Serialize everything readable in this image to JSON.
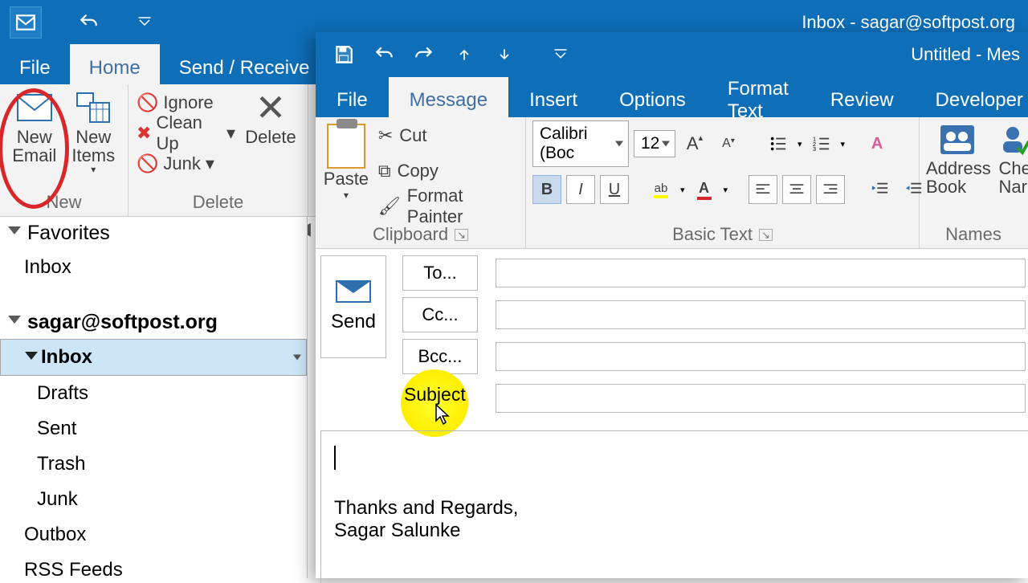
{
  "main": {
    "title_suffix": "Inbox - sagar@softpost.org",
    "menubar": {
      "file": "File",
      "home": "Home",
      "sendrecv": "Send / Receive"
    },
    "ribbon": {
      "new_email": "New\nEmail",
      "new_items": "New\nItems",
      "new_group": "New",
      "ignore": "Ignore",
      "cleanup": "Clean Up",
      "junk": "Junk",
      "delete": "Delete",
      "delete_group": "Delete"
    },
    "nav": {
      "favorites": "Favorites",
      "fav_inbox": "Inbox",
      "account": "sagar@softpost.org",
      "inbox": "Inbox",
      "drafts": "Drafts",
      "sent": "Sent",
      "trash": "Trash",
      "junk": "Junk",
      "outbox": "Outbox",
      "rss": "RSS Feeds"
    }
  },
  "compose": {
    "title": "Untitled - Mes",
    "tabs": {
      "file": "File",
      "message": "Message",
      "insert": "Insert",
      "options": "Options",
      "format": "Format Text",
      "review": "Review",
      "developer": "Developer"
    },
    "clipboard": {
      "paste": "Paste",
      "cut": "Cut",
      "copy": "Copy",
      "format_painter": "Format Painter",
      "group": "Clipboard"
    },
    "basic_text": {
      "font": "Calibri (Boc",
      "size": "12",
      "group": "Basic Text"
    },
    "names": {
      "address_book": "Address\nBook",
      "check_names": "Che\nNar",
      "group": "Names"
    },
    "header": {
      "to": "To...",
      "cc": "Cc...",
      "bcc": "Bcc...",
      "subject": "Subject",
      "send": "Send"
    },
    "body": {
      "line1": "Thanks and Regards,",
      "line2": "Sagar Salunke"
    }
  }
}
